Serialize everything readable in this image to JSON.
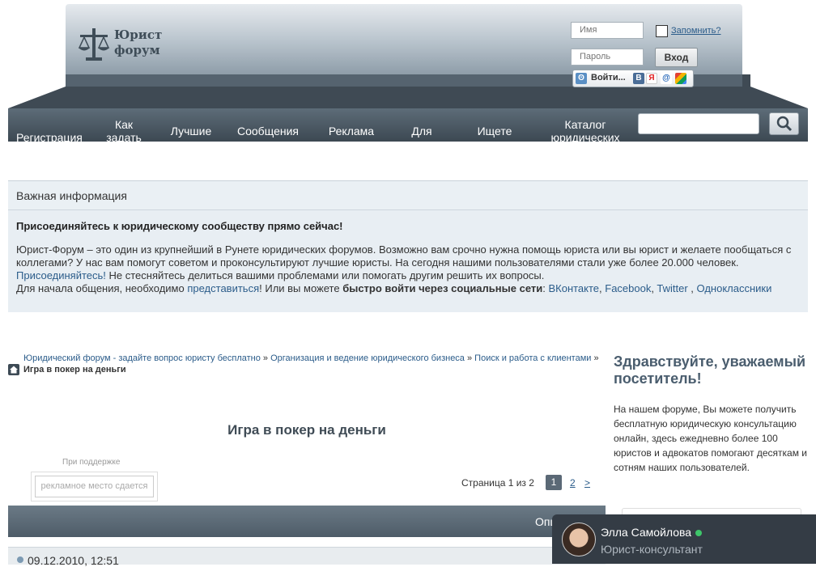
{
  "header": {
    "logo_line1": "Юрист",
    "logo_line2": "форум",
    "login_name_placeholder": "Имя",
    "login_password_placeholder": "Пароль",
    "remember_label": "Запомнить?",
    "login_button": "Вход",
    "social_login_label": "Войти...",
    "social_icons": [
      "loginza-icon",
      "vkontakte-icon",
      "yandex-icon",
      "mailru-icon",
      "google-icon"
    ]
  },
  "nav": {
    "items": [
      {
        "label": "Регистрация"
      },
      {
        "label": "Как задать вопрос"
      },
      {
        "label": "Лучшие"
      },
      {
        "label": "Сообщения"
      },
      {
        "label": "Реклама"
      },
      {
        "label": "Для"
      },
      {
        "label": "Ищете"
      },
      {
        "label": "Каталог юридических"
      }
    ]
  },
  "notice": {
    "title": "Важная информация",
    "headline": "Присоединяйтесь к юридическому сообществу прямо сейчас!",
    "p1": "Юрист-Форум – это один из крупнейший в Рунете юридических форумов. Возможно вам срочно нужна помощь юриста или вы юрист и желаете пообщаться с коллегами? У нас вам помогут советом и проконсультируют лучшие юристы. На сегодня нашими пользователями стали уже более 20.000 человек.",
    "join_link": "Присоединяйтесь!",
    "p2": " Не стесняйтесь делиться вашими проблемами или помогать другим решить их вопросы.",
    "p3_start": "Для начала общения, необходимо ",
    "introduce_link": "представиться",
    "p3_mid": "! Или вы можете ",
    "p3_bold": "быстро войти через социальные сети",
    "colon": ": ",
    "vk": "ВКонтакте",
    "comma1": ", ",
    "fb": "Facebook",
    "comma2": ", ",
    "tw": "Twitter",
    "comma3": " , ",
    "ok": "Одноклассники"
  },
  "breadcrumb": {
    "items": [
      "Юридический форум - задайте вопрос юристу бесплатно",
      "Организация и ведение юридического бизнеса",
      "Поиск и работа с клиентами"
    ],
    "sep": " » ",
    "current": "Игра в покер на деньги"
  },
  "thread": {
    "title": "Игра в покер на деньги",
    "ad_caption": "При поддержке",
    "ad_text": "рекламное место сдается",
    "pager_label": "Страница 1 из 2",
    "pager_current": "1",
    "pager_next_page": "2",
    "pager_next": ">",
    "options_label": "Опц",
    "post_date": "09.12.2010, 12:51"
  },
  "sidebar": {
    "greeting": "Здравствуйте, уважаемый посетитель!",
    "text": "На нашем форуме, Вы можете получить бесплатную юридическую консультацию онлайн, здесь ежедневно более 100 юристов и адвокатов помогают десяткам и сотням наших пользователей."
  },
  "chat": {
    "name": "Элла Самойлова",
    "role": "Юрист-консультант"
  }
}
